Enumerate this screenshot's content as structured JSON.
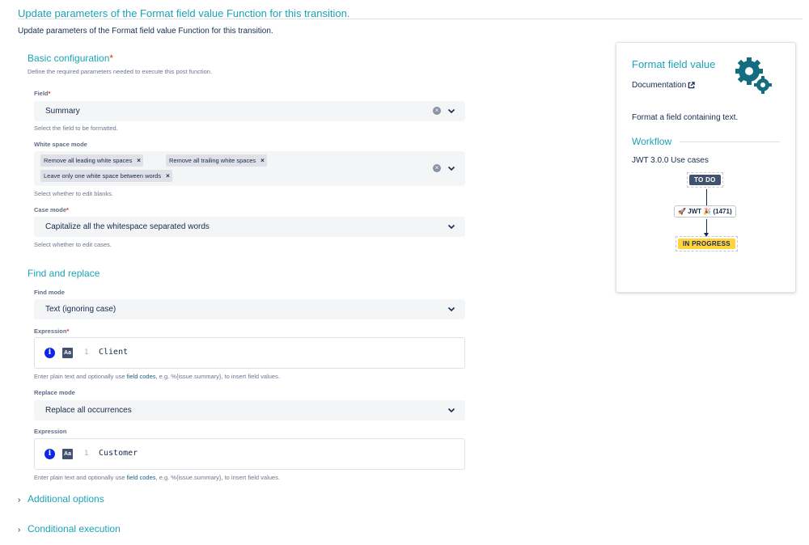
{
  "page": {
    "title": "Update parameters of the Format field value Function for this transition.",
    "subtitle": "Update parameters of the Format field value Function for this transition."
  },
  "basic": {
    "title": "Basic configuration",
    "required_mark": "*",
    "description": "Define the required parameters needed to execute this post function.",
    "field": {
      "label": "Field",
      "required_mark": "*",
      "value": "Summary",
      "help": "Select the field to be formatted."
    },
    "whitespace": {
      "label": "White space mode",
      "tags": [
        "Remove all leading white spaces",
        "Remove all trailing white spaces",
        "Leave only one white space between words"
      ],
      "remove_glyph": "×",
      "help": "Select whether to edit blanks."
    },
    "case": {
      "label": "Case mode",
      "required_mark": "*",
      "value": "Capitalize all the whitespace separated words",
      "help": "Select whether to edit cases."
    }
  },
  "find_replace": {
    "title": "Find and replace",
    "find_mode": {
      "label": "Find mode",
      "value": "Text (ignoring case)"
    },
    "expression1": {
      "label": "Expression",
      "required_mark": "*",
      "line_no": "1",
      "code": "Client",
      "help_pre": "Enter plain text and optionally use ",
      "help_link": "field codes",
      "help_post": ", e.g. %{issue.summary}, to insert field values."
    },
    "replace_mode": {
      "label": "Replace mode",
      "value": "Replace all occurrences"
    },
    "expression2": {
      "label": "Expression",
      "line_no": "1",
      "code": "Customer",
      "help_pre": "Enter plain text and optionally use ",
      "help_link": "field codes",
      "help_post": ", e.g. %{issue.summary}, to insert field values."
    }
  },
  "sections": {
    "additional": "Additional options",
    "conditional": "Conditional execution"
  },
  "card": {
    "title": "Format field value",
    "documentation": "Documentation",
    "description": "Format a field containing text.",
    "workflow_title": "Workflow",
    "use_cases": "JWT 3.0.0 Use cases",
    "status_from": "TO DO",
    "transition": "🚀 JWT 🎉 (1471)",
    "status_to": "IN PROGRESS"
  },
  "icons": {
    "info": "info-icon",
    "case_toggle": "aa-icon",
    "clear": "clear-icon",
    "chevron": "chevron-down-icon",
    "expand": "chevron-right-icon",
    "external": "external-link-icon",
    "gears": "gears-icon"
  },
  "colors": {
    "accent": "#1ba3b7",
    "required": "#de350b",
    "link": "#1a5f86",
    "status_todo": "#42526e",
    "status_in_progress": "#ffd43d",
    "info_icon": "#0d27ea"
  }
}
